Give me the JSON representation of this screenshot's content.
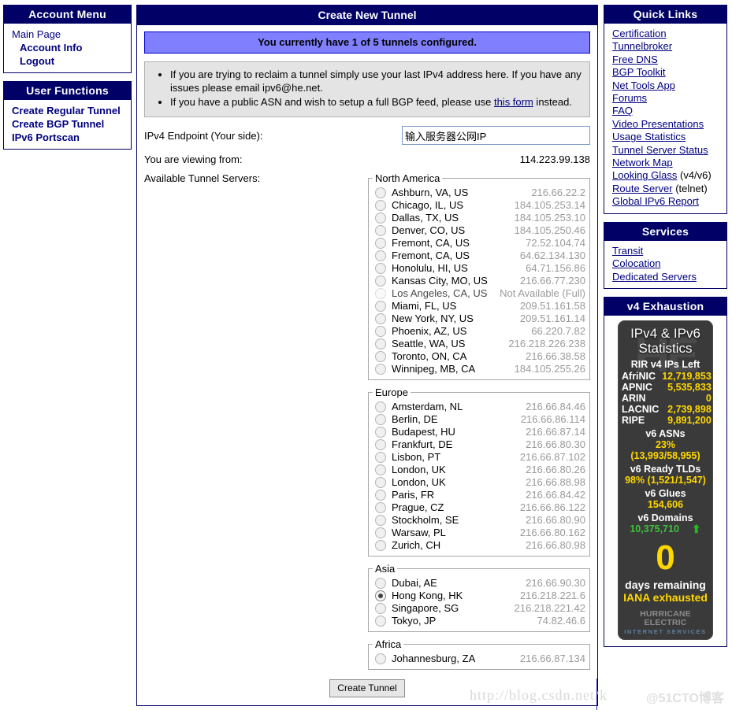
{
  "account_menu": {
    "title": "Account Menu",
    "items": [
      {
        "label": "Main Page",
        "style": "plain"
      },
      {
        "label": "Account Info",
        "style": "bold"
      },
      {
        "label": "Logout",
        "style": "bold"
      }
    ]
  },
  "user_functions": {
    "title": "User Functions",
    "items": [
      {
        "label": "Create Regular Tunnel"
      },
      {
        "label": "Create BGP Tunnel"
      },
      {
        "label": "IPv6 Portscan"
      }
    ]
  },
  "main": {
    "title": "Create New Tunnel",
    "notice": "You currently have 1 of 5 tunnels configured.",
    "info_bullets": [
      {
        "text_before": "If you are trying to reclaim a tunnel simply use your last IPv4 address here. If you have any issues please email ipv6@he.net.",
        "link": "",
        "text_after": ""
      },
      {
        "text_before": "If you have a public ASN and wish to setup a full BGP feed, please use ",
        "link": "this form",
        "text_after": " instead."
      }
    ],
    "endpoint_label": "IPv4 Endpoint (Your side):",
    "endpoint_value": "输入服务器公网IP",
    "endpoint_placeholder": "",
    "viewing_label": "You are viewing from:",
    "viewing_value": "114.223.99.138",
    "servers_label": "Available Tunnel Servers:",
    "create_button": "Create Tunnel"
  },
  "regions": [
    {
      "name": "North America",
      "servers": [
        {
          "city": "Ashburn, VA, US",
          "addr": "216.66.22.2",
          "state": "off"
        },
        {
          "city": "Chicago, IL, US",
          "addr": "184.105.253.14",
          "state": "off"
        },
        {
          "city": "Dallas, TX, US",
          "addr": "184.105.253.10",
          "state": "off"
        },
        {
          "city": "Denver, CO, US",
          "addr": "184.105.250.46",
          "state": "off"
        },
        {
          "city": "Fremont, CA, US",
          "addr": "72.52.104.74",
          "state": "off"
        },
        {
          "city": "Fremont, CA, US",
          "addr": "64.62.134.130",
          "state": "off"
        },
        {
          "city": "Honolulu, HI, US",
          "addr": "64.71.156.86",
          "state": "off"
        },
        {
          "city": "Kansas City, MO, US",
          "addr": "216.66.77.230",
          "state": "off"
        },
        {
          "city": "Los Angeles, CA, US",
          "addr": "Not Available (Full)",
          "state": "disabled"
        },
        {
          "city": "Miami, FL, US",
          "addr": "209.51.161.58",
          "state": "off"
        },
        {
          "city": "New York, NY, US",
          "addr": "209.51.161.14",
          "state": "off"
        },
        {
          "city": "Phoenix, AZ, US",
          "addr": "66.220.7.82",
          "state": "off"
        },
        {
          "city": "Seattle, WA, US",
          "addr": "216.218.226.238",
          "state": "off"
        },
        {
          "city": "Toronto, ON, CA",
          "addr": "216.66.38.58",
          "state": "off"
        },
        {
          "city": "Winnipeg, MB, CA",
          "addr": "184.105.255.26",
          "state": "off"
        }
      ]
    },
    {
      "name": "Europe",
      "servers": [
        {
          "city": "Amsterdam, NL",
          "addr": "216.66.84.46",
          "state": "off"
        },
        {
          "city": "Berlin, DE",
          "addr": "216.66.86.114",
          "state": "off"
        },
        {
          "city": "Budapest, HU",
          "addr": "216.66.87.14",
          "state": "off"
        },
        {
          "city": "Frankfurt, DE",
          "addr": "216.66.80.30",
          "state": "off"
        },
        {
          "city": "Lisbon, PT",
          "addr": "216.66.87.102",
          "state": "off"
        },
        {
          "city": "London, UK",
          "addr": "216.66.80.26",
          "state": "off"
        },
        {
          "city": "London, UK",
          "addr": "216.66.88.98",
          "state": "off"
        },
        {
          "city": "Paris, FR",
          "addr": "216.66.84.42",
          "state": "off"
        },
        {
          "city": "Prague, CZ",
          "addr": "216.66.86.122",
          "state": "off"
        },
        {
          "city": "Stockholm, SE",
          "addr": "216.66.80.90",
          "state": "off"
        },
        {
          "city": "Warsaw, PL",
          "addr": "216.66.80.162",
          "state": "off"
        },
        {
          "city": "Zurich, CH",
          "addr": "216.66.80.98",
          "state": "off"
        }
      ]
    },
    {
      "name": "Asia",
      "servers": [
        {
          "city": "Dubai, AE",
          "addr": "216.66.90.30",
          "state": "off"
        },
        {
          "city": "Hong Kong, HK",
          "addr": "216.218.221.6",
          "state": "checked"
        },
        {
          "city": "Singapore, SG",
          "addr": "216.218.221.42",
          "state": "off"
        },
        {
          "city": "Tokyo, JP",
          "addr": "74.82.46.6",
          "state": "off"
        }
      ]
    },
    {
      "name": "Africa",
      "servers": [
        {
          "city": "Johannesburg, ZA",
          "addr": "216.66.87.134",
          "state": "off"
        }
      ]
    }
  ],
  "quick_links": {
    "title": "Quick Links",
    "items": [
      {
        "label": "Certification",
        "suffix": ""
      },
      {
        "label": "Tunnelbroker",
        "suffix": ""
      },
      {
        "label": "Free DNS",
        "suffix": ""
      },
      {
        "label": "BGP Toolkit",
        "suffix": ""
      },
      {
        "label": "Net Tools App",
        "suffix": ""
      },
      {
        "label": "Forums",
        "suffix": ""
      },
      {
        "label": "FAQ",
        "suffix": ""
      },
      {
        "label": "Video Presentations",
        "suffix": ""
      },
      {
        "label": "Usage Statistics",
        "suffix": ""
      },
      {
        "label": "Tunnel Server Status",
        "suffix": ""
      },
      {
        "label": "Network Map",
        "suffix": ""
      },
      {
        "label": "Looking Glass",
        "suffix": " (v4/v6)"
      },
      {
        "label": "Route Server",
        "suffix": " (telnet)"
      },
      {
        "label": "Global IPv6 Report",
        "suffix": ""
      }
    ]
  },
  "services": {
    "title": "Services",
    "items": [
      {
        "label": "Transit"
      },
      {
        "label": "Colocation"
      },
      {
        "label": "Dedicated Servers"
      }
    ]
  },
  "v4_exhaustion": {
    "title": "v4 Exhaustion",
    "widget_title_line1": "IPv4 & IPv6",
    "widget_title_line2": "Statistics",
    "rir_heading": "RIR v4 IPs Left",
    "rirs": [
      {
        "name": "AfriNIC",
        "value": "12,719,853"
      },
      {
        "name": "APNIC",
        "value": "5,535,833"
      },
      {
        "name": "ARIN",
        "value": "0"
      },
      {
        "name": "LACNIC",
        "value": "2,739,898"
      },
      {
        "name": "RIPE",
        "value": "9,891,200"
      }
    ],
    "v6_asns_label": "v6 ASNs",
    "v6_asns_value": "23% (13,993/58,955)",
    "v6_tlds_label": "v6 Ready TLDs",
    "v6_tlds_value": "98% (1,521/1,547)",
    "v6_glues_label": "v6 Glues",
    "v6_glues_value": "154,606",
    "v6_domains_label": "v6 Domains",
    "v6_domains_value": "10,375,710",
    "days_number": "0",
    "days_label": "days remaining",
    "iana_label": "IANA exhausted",
    "brand": "HURRICANE ELECTRIC",
    "brand_sub": "INTERNET SERVICES"
  },
  "watermarks": {
    "url": "http://blog.csdn.net/k",
    "cto": "@51CTO博客"
  }
}
